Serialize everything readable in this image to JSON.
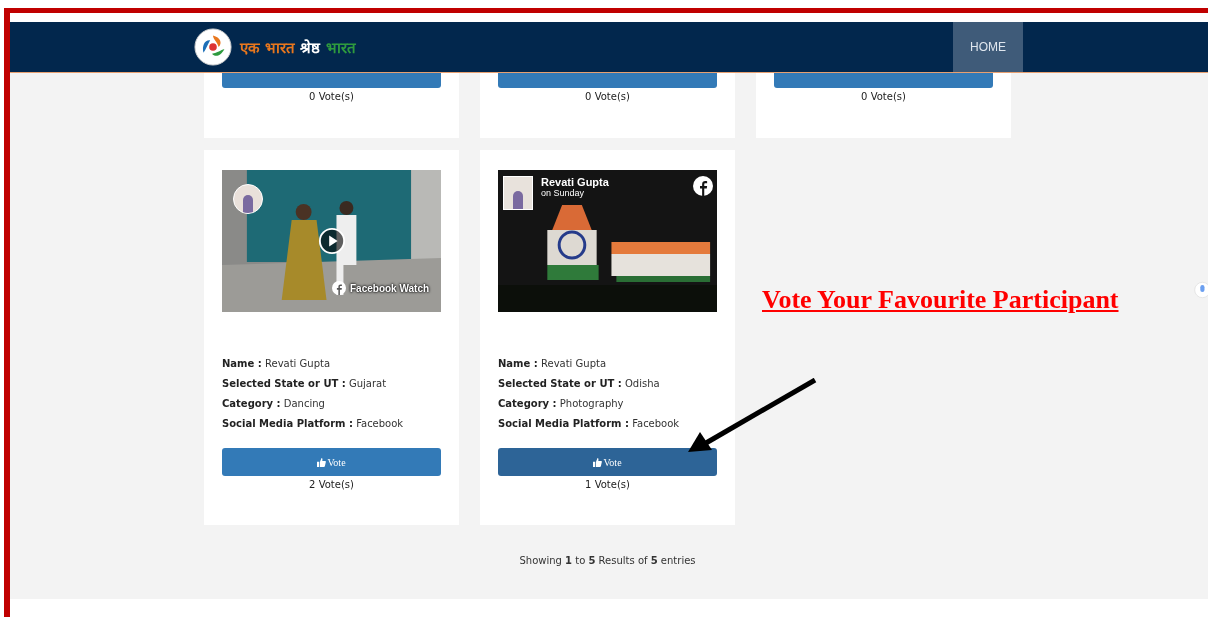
{
  "header": {
    "logo_text": [
      {
        "text": "एक भारत",
        "color": "#e8771e"
      },
      {
        "text": "श्रेष्ठ",
        "color": "#ffffff"
      },
      {
        "text": "भारत",
        "color": "#2e9a3e"
      }
    ],
    "nav": [
      {
        "label": "HOME",
        "selected": true
      }
    ]
  },
  "top_cards": [
    {
      "votes": "0 Vote(s)"
    },
    {
      "votes": "0 Vote(s)"
    },
    {
      "votes": "0 Vote(s)"
    }
  ],
  "cards": [
    {
      "media": {
        "kind": "watch",
        "overlay": "Facebook Watch"
      },
      "fields": [
        {
          "label": "Name :",
          "value": "Revati Gupta"
        },
        {
          "label": "Selected State or UT :",
          "value": "Gujarat"
        },
        {
          "label": "Category :",
          "value": "Dancing"
        },
        {
          "label": "Social Media Platform :",
          "value": "Facebook"
        }
      ],
      "button": {
        "label": "Vote",
        "hovered": false
      },
      "votes": "2 Vote(s)"
    },
    {
      "media": {
        "kind": "post",
        "author": "Revati Gupta",
        "time": "on Sunday"
      },
      "fields": [
        {
          "label": "Name :",
          "value": "Revati Gupta"
        },
        {
          "label": "Selected State or UT :",
          "value": "Odisha"
        },
        {
          "label": "Category :",
          "value": "Photography"
        },
        {
          "label": "Social Media Platform :",
          "value": "Facebook"
        }
      ],
      "button": {
        "label": "Vote",
        "hovered": true
      },
      "votes": "1 Vote(s)"
    }
  ],
  "pagination": "Showing **1** to **5** Results of **5** entries",
  "annotation": {
    "text": "Vote Your Favourite Participant"
  }
}
